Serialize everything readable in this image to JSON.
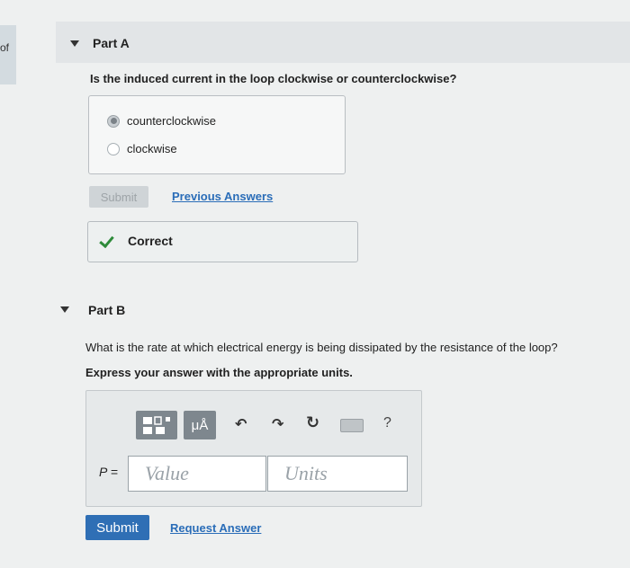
{
  "left_fragment": "of",
  "part_a": {
    "title": "Part A",
    "question": "Is the induced current in the loop clockwise or counterclockwise?",
    "options": [
      {
        "label": "counterclockwise",
        "selected": true
      },
      {
        "label": "clockwise",
        "selected": false
      }
    ],
    "submit_label": "Submit",
    "previous_answers_label": "Previous Answers",
    "feedback": "Correct"
  },
  "part_b": {
    "title": "Part B",
    "question": "What is the rate at which electrical energy is being dissipated by the resistance of the loop?",
    "instruction": "Express your answer with the appropriate units.",
    "toolbar": {
      "unit_button_label": "μÅ",
      "help_label": "?",
      "icons": [
        "templates-icon",
        "units-icon",
        "undo-icon",
        "redo-icon",
        "reset-icon",
        "keyboard-icon",
        "help-icon"
      ]
    },
    "variable_label": "P =",
    "value_placeholder": "Value",
    "units_placeholder": "Units",
    "submit_label": "Submit",
    "request_answer_label": "Request Answer"
  },
  "colors": {
    "link": "#2a6db8",
    "submit_button": "#2f6fb5",
    "check": "#2e8b3a",
    "toolbar_button": "#7e878e"
  }
}
